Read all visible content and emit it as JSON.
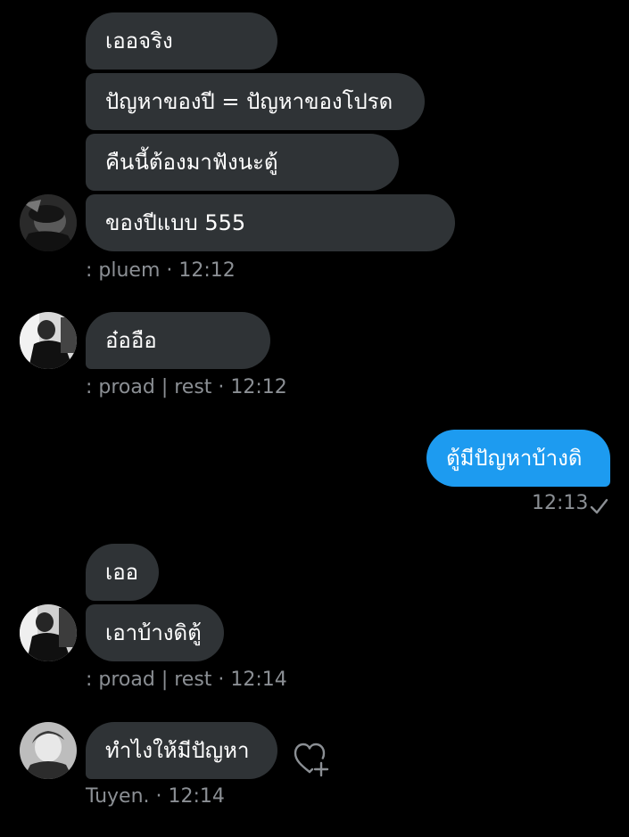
{
  "conversation": {
    "group1": {
      "messages": [
        "เออจริง",
        "ปัญหาของปี = ปัญหาของโปรด",
        "คืนนี้ต้องมาฟังนะตู้",
        "ของปีแบบ 555"
      ],
      "meta": ": pluem · 12:12"
    },
    "group2": {
      "messages": [
        "อ๋ออือ"
      ],
      "meta": ": proad | rest · 12:12"
    },
    "outgoing": {
      "message": "ตู้มีปัญหาบ้างดิ",
      "time": "12:13",
      "status_icon": "checkmark-icon"
    },
    "group3": {
      "messages": [
        "เออ",
        "เอาบ้างดิตู้"
      ],
      "meta": ": proad | rest · 12:14"
    },
    "group4": {
      "messages": [
        "ทำไงให้มีปัญหา"
      ],
      "meta": "Tuyen. · 12:14",
      "reaction_icon": "heart-plus-icon"
    }
  },
  "colors": {
    "background": "#000000",
    "incoming_bubble": "#2f3336",
    "outgoing_bubble": "#1d9bf0",
    "meta_text": "#8b8f94"
  }
}
